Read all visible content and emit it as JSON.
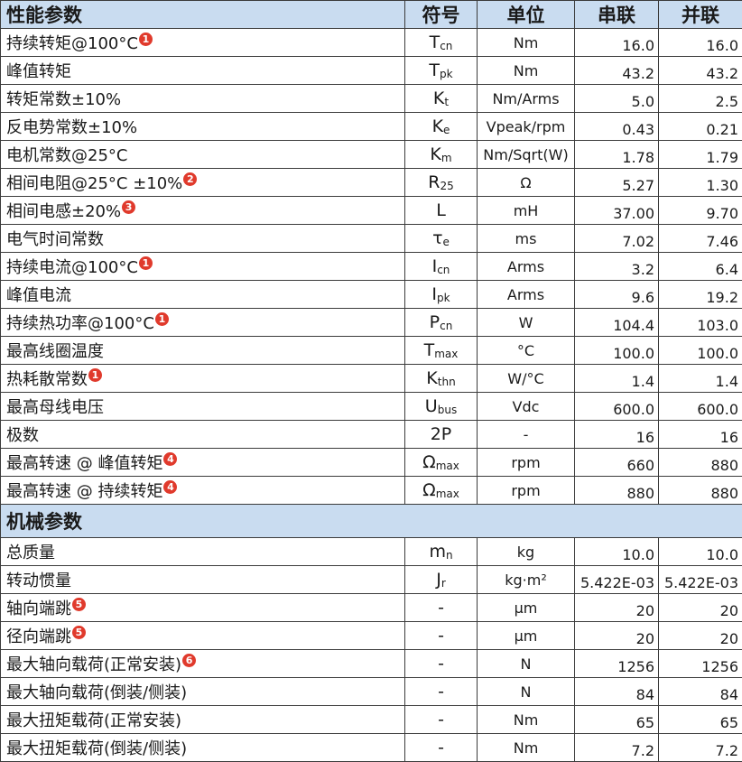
{
  "header": {
    "param": "性能参数",
    "symbol": "符号",
    "unit": "单位",
    "series": "串联",
    "parallel": "并联"
  },
  "performance_rows": [
    {
      "name": "持续转矩@100°C",
      "note": "1",
      "sym": "T",
      "sub": "cn",
      "unit": "Nm",
      "series": "16.0",
      "parallel": "16.0"
    },
    {
      "name": "峰值转矩",
      "note": "",
      "sym": "T",
      "sub": "pk",
      "unit": "Nm",
      "series": "43.2",
      "parallel": "43.2"
    },
    {
      "name": "转矩常数±10%",
      "note": "",
      "sym": "K",
      "sub": "t",
      "unit": "Nm/Arms",
      "series": "5.0",
      "parallel": "2.5"
    },
    {
      "name": "反电势常数±10%",
      "note": "",
      "sym": "K",
      "sub": "e",
      "unit": "Vpeak/rpm",
      "series": "0.43",
      "parallel": "0.21"
    },
    {
      "name": "电机常数@25°C",
      "note": "",
      "sym": "K",
      "sub": "m",
      "unit": "Nm/Sqrt(W)",
      "series": "1.78",
      "parallel": "1.79"
    },
    {
      "name": "相间电阻@25°C ±10%",
      "note": "2",
      "sym": "R",
      "sub": "25",
      "unit": "Ω",
      "series": "5.27",
      "parallel": "1.30"
    },
    {
      "name": "相间电感±20%",
      "note": "3",
      "sym": "L",
      "sub": "",
      "unit": "mH",
      "series": "37.00",
      "parallel": "9.70"
    },
    {
      "name": "电气时间常数",
      "note": "",
      "sym": "τ",
      "sub": "e",
      "unit": "ms",
      "series": "7.02",
      "parallel": "7.46"
    },
    {
      "name": "持续电流@100°C",
      "note": "1",
      "sym": "I",
      "sub": "cn",
      "unit": "Arms",
      "series": "3.2",
      "parallel": "6.4"
    },
    {
      "name": "峰值电流",
      "note": "",
      "sym": "I",
      "sub": "pk",
      "unit": "Arms",
      "series": "9.6",
      "parallel": "19.2"
    },
    {
      "name": "持续热功率@100°C",
      "note": "1",
      "sym": "P",
      "sub": "cn",
      "unit": "W",
      "series": "104.4",
      "parallel": "103.0"
    },
    {
      "name": "最高线圈温度",
      "note": "",
      "sym": "T",
      "sub": "max",
      "unit": "°C",
      "series": "100.0",
      "parallel": "100.0"
    },
    {
      "name": "热耗散常数",
      "note": "1",
      "sym": "K",
      "sub": "thn",
      "unit": "W/°C",
      "series": "1.4",
      "parallel": "1.4"
    },
    {
      "name": "最高母线电压",
      "note": "",
      "sym": "U",
      "sub": "bus",
      "unit": "Vdc",
      "series": "600.0",
      "parallel": "600.0"
    },
    {
      "name": "极数",
      "note": "",
      "sym": "2P",
      "sub": "",
      "unit": "-",
      "series": "16",
      "parallel": "16"
    },
    {
      "name": "最高转速 @ 峰值转矩",
      "note": "4",
      "sym": "Ω",
      "sub": "max",
      "unit": "rpm",
      "series": "660",
      "parallel": "880"
    },
    {
      "name": "最高转速 @ 持续转矩",
      "note": "4",
      "sym": "Ω",
      "sub": "max",
      "unit": "rpm",
      "series": "880",
      "parallel": "880"
    }
  ],
  "mechanical_header": "机械参数",
  "mechanical_rows": [
    {
      "name": "总质量",
      "note": "",
      "sym": "m",
      "sub": "n",
      "unit": "kg",
      "series": "10.0",
      "parallel": "10.0"
    },
    {
      "name": "转动惯量",
      "note": "",
      "sym": "J",
      "sub": "r",
      "unit": "kg·m²",
      "series": "5.422E-03",
      "parallel": "5.422E-03"
    },
    {
      "name": "轴向端跳",
      "note": "5",
      "sym": "-",
      "sub": "",
      "unit": "μm",
      "series": "20",
      "parallel": "20"
    },
    {
      "name": "径向端跳",
      "note": "5",
      "sym": "-",
      "sub": "",
      "unit": "μm",
      "series": "20",
      "parallel": "20"
    },
    {
      "name": "最大轴向载荷(正常安装)",
      "note": "6",
      "sym": "-",
      "sub": "",
      "unit": "N",
      "series": "1256",
      "parallel": "1256"
    },
    {
      "name": "最大轴向载荷(倒装/侧装)",
      "note": "",
      "sym": "-",
      "sub": "",
      "unit": "N",
      "series": "84",
      "parallel": "84"
    },
    {
      "name": "最大扭矩载荷(正常安装)",
      "note": "",
      "sym": "-",
      "sub": "",
      "unit": "Nm",
      "series": "65",
      "parallel": "65"
    },
    {
      "name": "最大扭矩载荷(倒装/侧装)",
      "note": "",
      "sym": "-",
      "sub": "",
      "unit": "Nm",
      "series": "7.2",
      "parallel": "7.2"
    }
  ],
  "colors": {
    "header_bg": "#c9dcf0",
    "note_badge": "#e03a2c"
  }
}
